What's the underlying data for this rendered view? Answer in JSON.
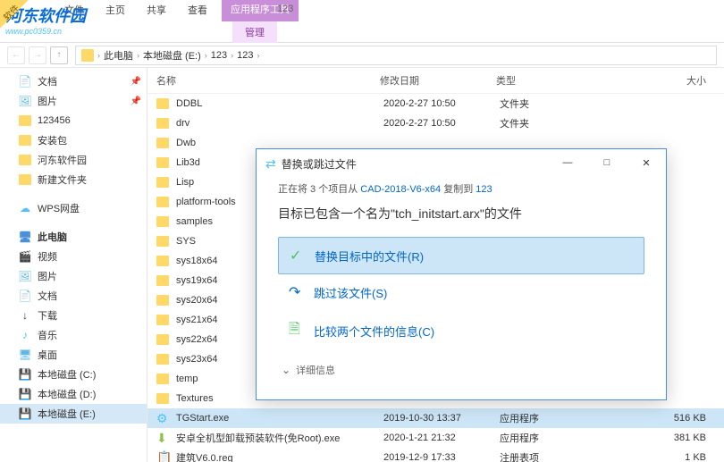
{
  "watermark": {
    "logo": "河东软件园",
    "sub": "www.pc0359.cn",
    "corner": "软件"
  },
  "ribbon": {
    "context_tab": "应用程序工具",
    "tabs": [
      "文件",
      "主页",
      "共享",
      "查看"
    ],
    "tab_manage": "管理",
    "window_title": "123"
  },
  "breadcrumb": {
    "segments": [
      "此电脑",
      "本地磁盘 (E:)",
      "123",
      "123"
    ]
  },
  "sidebar": {
    "items": [
      {
        "label": "文档",
        "icon": "doc",
        "pinned": true
      },
      {
        "label": "图片",
        "icon": "pic",
        "pinned": true
      },
      {
        "label": "123456",
        "icon": "folder"
      },
      {
        "label": "安装包",
        "icon": "folder"
      },
      {
        "label": "河东软件园",
        "icon": "folder"
      },
      {
        "label": "新建文件夹",
        "icon": "folder"
      }
    ],
    "wps": "WPS网盘",
    "pc": "此电脑",
    "pc_items": [
      {
        "label": "视频",
        "icon": "video"
      },
      {
        "label": "图片",
        "icon": "pic"
      },
      {
        "label": "文档",
        "icon": "doc"
      },
      {
        "label": "下载",
        "icon": "dl"
      },
      {
        "label": "音乐",
        "icon": "music"
      },
      {
        "label": "桌面",
        "icon": "desk"
      },
      {
        "label": "本地磁盘 (C:)",
        "icon": "disk"
      },
      {
        "label": "本地磁盘 (D:)",
        "icon": "disk"
      },
      {
        "label": "本地磁盘 (E:)",
        "icon": "disk",
        "selected": true
      }
    ]
  },
  "columns": {
    "name": "名称",
    "date": "修改日期",
    "type": "类型",
    "size": "大小"
  },
  "files": [
    {
      "name": "DDBL",
      "date": "2020-2-27 10:50",
      "type": "文件夹",
      "size": "",
      "kind": "folder"
    },
    {
      "name": "drv",
      "date": "2020-2-27 10:50",
      "type": "文件夹",
      "size": "",
      "kind": "folder"
    },
    {
      "name": "Dwb",
      "date": "",
      "type": "",
      "size": "",
      "kind": "folder"
    },
    {
      "name": "Lib3d",
      "date": "",
      "type": "",
      "size": "",
      "kind": "folder"
    },
    {
      "name": "Lisp",
      "date": "",
      "type": "",
      "size": "",
      "kind": "folder"
    },
    {
      "name": "platform-tools",
      "date": "",
      "type": "",
      "size": "",
      "kind": "folder"
    },
    {
      "name": "samples",
      "date": "",
      "type": "",
      "size": "",
      "kind": "folder"
    },
    {
      "name": "SYS",
      "date": "",
      "type": "",
      "size": "",
      "kind": "folder"
    },
    {
      "name": "sys18x64",
      "date": "",
      "type": "",
      "size": "",
      "kind": "folder"
    },
    {
      "name": "sys19x64",
      "date": "",
      "type": "",
      "size": "",
      "kind": "folder"
    },
    {
      "name": "sys20x64",
      "date": "",
      "type": "",
      "size": "",
      "kind": "folder"
    },
    {
      "name": "sys21x64",
      "date": "",
      "type": "",
      "size": "",
      "kind": "folder"
    },
    {
      "name": "sys22x64",
      "date": "",
      "type": "",
      "size": "",
      "kind": "folder"
    },
    {
      "name": "sys23x64",
      "date": "",
      "type": "",
      "size": "",
      "kind": "folder"
    },
    {
      "name": "temp",
      "date": "",
      "type": "",
      "size": "",
      "kind": "folder"
    },
    {
      "name": "Textures",
      "date": "",
      "type": "",
      "size": "",
      "kind": "folder"
    },
    {
      "name": "TGStart.exe",
      "date": "2019-10-30 13:37",
      "type": "应用程序",
      "size": "516 KB",
      "kind": "exe",
      "highlighted": true
    },
    {
      "name": "安卓全机型卸载预装软件(免Root).exe",
      "date": "2020-1-21 21:32",
      "type": "应用程序",
      "size": "381 KB",
      "kind": "apk"
    },
    {
      "name": "建筑V6.0.reg",
      "date": "2019-12-9 17:33",
      "type": "注册表项",
      "size": "1 KB",
      "kind": "reg"
    }
  ],
  "dialog": {
    "title": "替换或跳过文件",
    "copying_prefix": "正在将 3 个项目从 ",
    "copying_src": "CAD-2018-V6-x64",
    "copying_mid": " 复制到 ",
    "copying_dst": "123",
    "conflict": "目标已包含一个名为\"tch_initstart.arx\"的文件",
    "actions": [
      {
        "label": "替换目标中的文件(R)",
        "icon": "check",
        "selected": true
      },
      {
        "label": "跳过该文件(S)",
        "icon": "skip"
      },
      {
        "label": "比较两个文件的信息(C)",
        "icon": "compare"
      }
    ],
    "details": "详细信息"
  }
}
